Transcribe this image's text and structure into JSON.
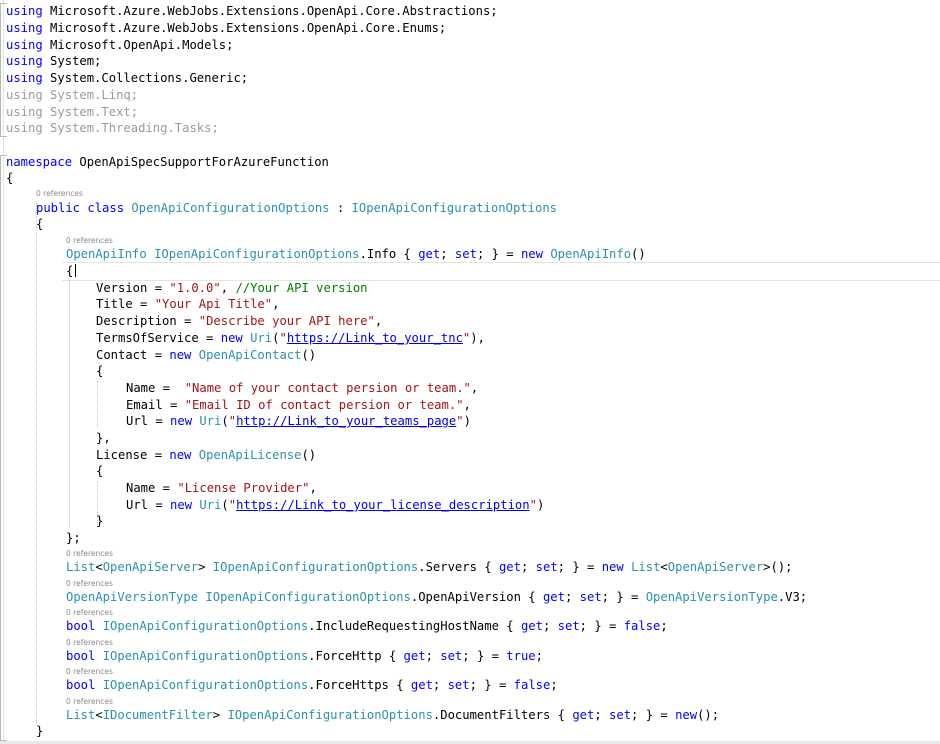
{
  "editor": {
    "code_lens": "0 references",
    "usings": [
      "Microsoft.Azure.WebJobs.Extensions.OpenApi.Core.Abstractions;",
      "Microsoft.Azure.WebJobs.Extensions.OpenApi.Core.Enums;",
      "Microsoft.OpenApi.Models;",
      "System;",
      "System.Collections.Generic;",
      "System.Linq;",
      "System.Text;",
      "System.Threading.Tasks;"
    ],
    "namespace_name": "OpenApiSpecSupportForAzureFunction",
    "class_name": "OpenApiConfigurationOptions",
    "interface_name": "IOpenApiConfigurationOptions",
    "info": {
      "version": "\"1.0.0\"",
      "version_comment": "//Your API version",
      "title": "\"Your Api Title\"",
      "description": "\"Describe your API here\"",
      "tos_url": "https://Link_to_your_tnc",
      "contact_name": "\"Name of your contact persion or team.\"",
      "contact_email": "\"Email ID of contact persion or team.\"",
      "contact_url": "http://Link_to_your_teams_page",
      "license_name": "\"License Provider\"",
      "license_url": "https://Link_to_your_license_description"
    },
    "values": {
      "openapi_version": ".V3;",
      "include_host": "false",
      "force_http": "true",
      "force_https": "false"
    }
  }
}
